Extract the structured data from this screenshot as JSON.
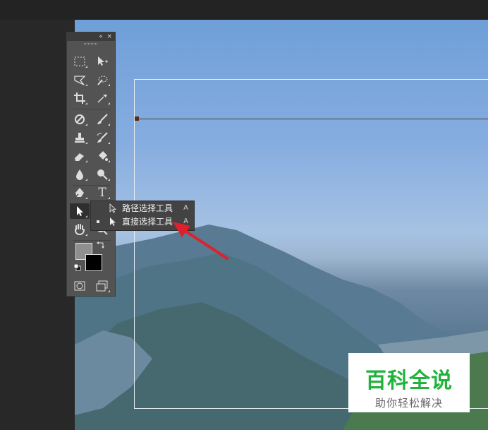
{
  "toolbar": {
    "collapse_glyph": "«",
    "close_glyph": "×"
  },
  "flyout": {
    "items": [
      {
        "label": "路径选择工具",
        "shortcut": "A",
        "selected": false
      },
      {
        "label": "直接选择工具",
        "shortcut": "A",
        "selected": true
      }
    ]
  },
  "tools": {
    "type_glyph": "T"
  },
  "watermark": {
    "title": "百科全说",
    "subtitle": "助你轻松解决",
    "title_color": "#1fb33c"
  },
  "colors": {
    "annotation_arrow": "#e0202a",
    "panel_bg": "#535353",
    "foreground_swatch": "#8f8f8f",
    "background_swatch": "#000000"
  },
  "icons": [
    "rect-marquee-icon",
    "move-icon",
    "lasso-icon",
    "quick-select-icon",
    "crop-icon",
    "eyedropper-icon",
    "healing-brush-icon",
    "brush-icon",
    "clone-stamp-icon",
    "history-brush-icon",
    "eraser-icon",
    "paint-bucket-icon",
    "blur-icon",
    "dodge-icon",
    "pen-icon",
    "type-icon",
    "path-select-icon",
    "shape-icon",
    "hand-icon",
    "zoom-icon",
    "swap-colors-icon",
    "default-colors-icon",
    "quick-mask-icon",
    "screen-mode-icon"
  ]
}
